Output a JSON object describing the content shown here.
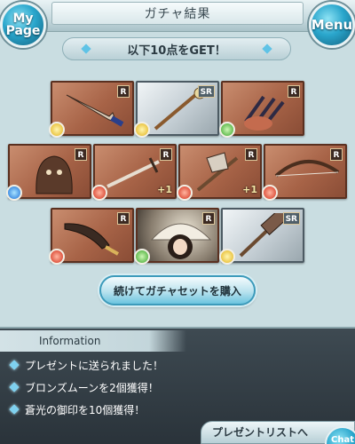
{
  "header": {
    "title": "ガチャ結果",
    "mypage_label": "My Page",
    "menu_label": "Menu"
  },
  "banner": {
    "text": "以下10点をGET！"
  },
  "items": [
    {
      "name": "dagger-weapon",
      "rarity": "R",
      "element": "light",
      "plus": "",
      "style": "bronze",
      "icon": "dagger-icon"
    },
    {
      "name": "staff-weapon",
      "rarity": "SR",
      "element": "light",
      "plus": "",
      "style": "silver",
      "icon": "staff-icon"
    },
    {
      "name": "claw-weapon",
      "rarity": "R",
      "element": "wind",
      "plus": "",
      "style": "bronze",
      "icon": "claw-icon"
    },
    {
      "name": "summon-creature",
      "rarity": "R",
      "element": "water",
      "plus": "",
      "style": "bronze",
      "icon": "summon-icon"
    },
    {
      "name": "sword-weapon",
      "rarity": "R",
      "element": "fire",
      "plus": "+1",
      "style": "bronze",
      "icon": "sword-icon"
    },
    {
      "name": "axe-weapon",
      "rarity": "R",
      "element": "fire",
      "plus": "+1",
      "style": "bronze",
      "icon": "axe-icon"
    },
    {
      "name": "bow-weapon",
      "rarity": "R",
      "element": "fire",
      "plus": "",
      "style": "bronze",
      "icon": "bow-icon"
    },
    {
      "name": "scimitar-weapon",
      "rarity": "R",
      "element": "fire",
      "plus": "",
      "style": "bronze",
      "icon": "scimitar-icon"
    },
    {
      "name": "character-portrait",
      "rarity": "R",
      "element": "wind",
      "plus": "",
      "style": "portrait",
      "icon": "character-icon"
    },
    {
      "name": "hammer-weapon",
      "rarity": "SR",
      "element": "light",
      "plus": "",
      "style": "silver",
      "icon": "hammer-icon"
    }
  ],
  "buy_button": {
    "label": "続けてガチャセットを購入"
  },
  "information": {
    "title": "Information",
    "lines": [
      "プレゼントに送られました！",
      "ブロンズムーンを2個獲得！",
      "蒼光の御印を10個獲得！"
    ]
  },
  "footer": {
    "present_list_label": "プレゼントリストへ",
    "chat_label": "Chat"
  }
}
